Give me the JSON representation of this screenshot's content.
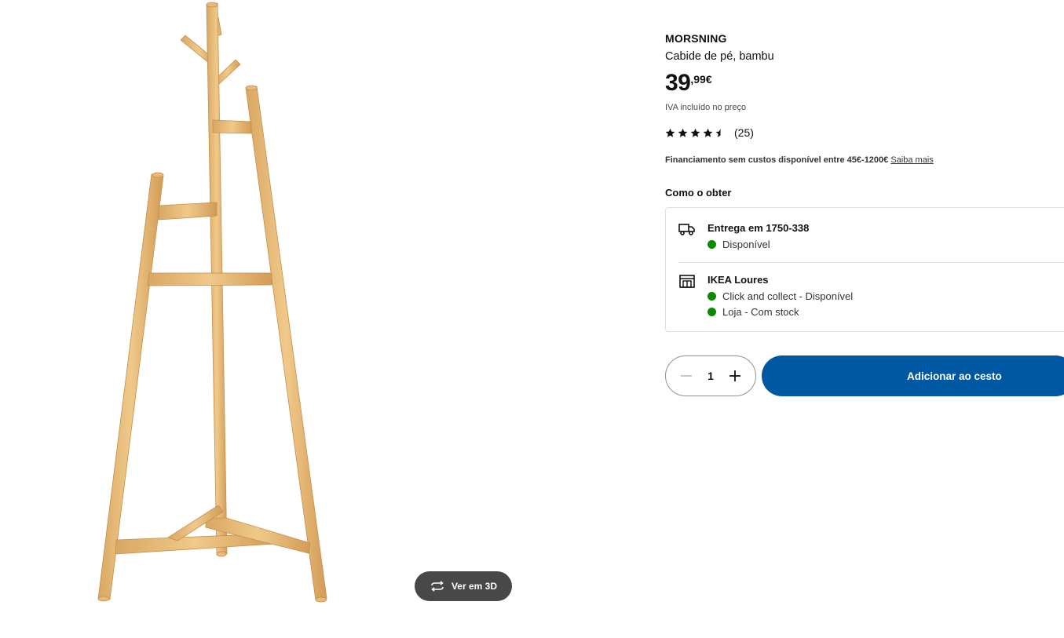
{
  "product": {
    "name": "MORSNING",
    "description": "Cabide de pé, bambu",
    "price_integer": "39",
    "price_decimal": ",99",
    "price_currency": "€",
    "vat_note": "IVA incluído no preço",
    "rating_value": 4.5,
    "rating_max": 5,
    "review_count": "(25)"
  },
  "finance": {
    "text": "Financiamento sem custos disponível entre 45€-1200€",
    "link": "Saiba mais"
  },
  "how_to_get": {
    "heading": "Como o obter",
    "delivery": {
      "title": "Entrega em 1750-338",
      "status": "Disponível",
      "icon": "truck-icon"
    },
    "store": {
      "title": "IKEA Loures",
      "statuses": [
        "Click and collect - Disponível",
        "Loja - Com stock"
      ],
      "icon": "store-icon"
    },
    "status_color": "#0a8a00"
  },
  "cart": {
    "quantity": "1",
    "add_label": "Adicionar ao cesto",
    "button_color": "#0058a3"
  },
  "gallery": {
    "view_3d_label": "Ver em 3D"
  }
}
